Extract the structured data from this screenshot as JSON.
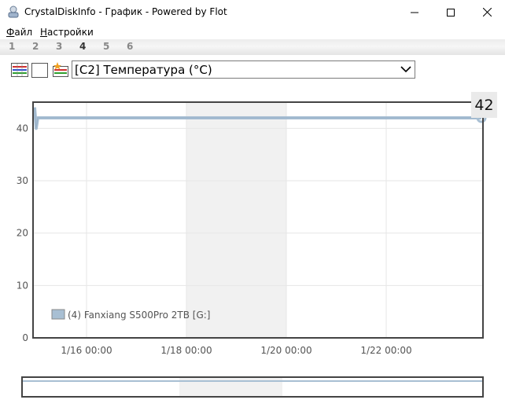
{
  "window": {
    "title": "CrystalDiskInfo - График - Powered by Flot"
  },
  "menu": {
    "file_acc": "Ф",
    "file_rest": "айл",
    "settings_acc": "Н",
    "settings_rest": "астройки"
  },
  "disk_tabs": [
    "1",
    "2",
    "3",
    "4",
    "5",
    "6"
  ],
  "active_disk_tab": "4",
  "attribute_select": {
    "selected": "[C2] Температура (°C)"
  },
  "current_value": "42",
  "colors": {
    "series": "#a8bfd3",
    "series_edge": "#8fa9c1",
    "grid": "#e6e6e6",
    "band": "#f1f1f1"
  },
  "chart_data": {
    "type": "line",
    "ylim": [
      0,
      45
    ],
    "yticks": [
      "0",
      "10",
      "20",
      "30",
      "40"
    ],
    "xticks": [
      "1/16 00:00",
      "1/18 00:00",
      "1/20 00:00",
      "1/22 00:00"
    ],
    "series": [
      {
        "name": "(4) Fanxiang S500Pro 2TB [G:]",
        "values": [
          44,
          40,
          42,
          42,
          42,
          42,
          42,
          42,
          42,
          42,
          42
        ]
      }
    ],
    "legend": "bottom-left",
    "grid": true
  }
}
